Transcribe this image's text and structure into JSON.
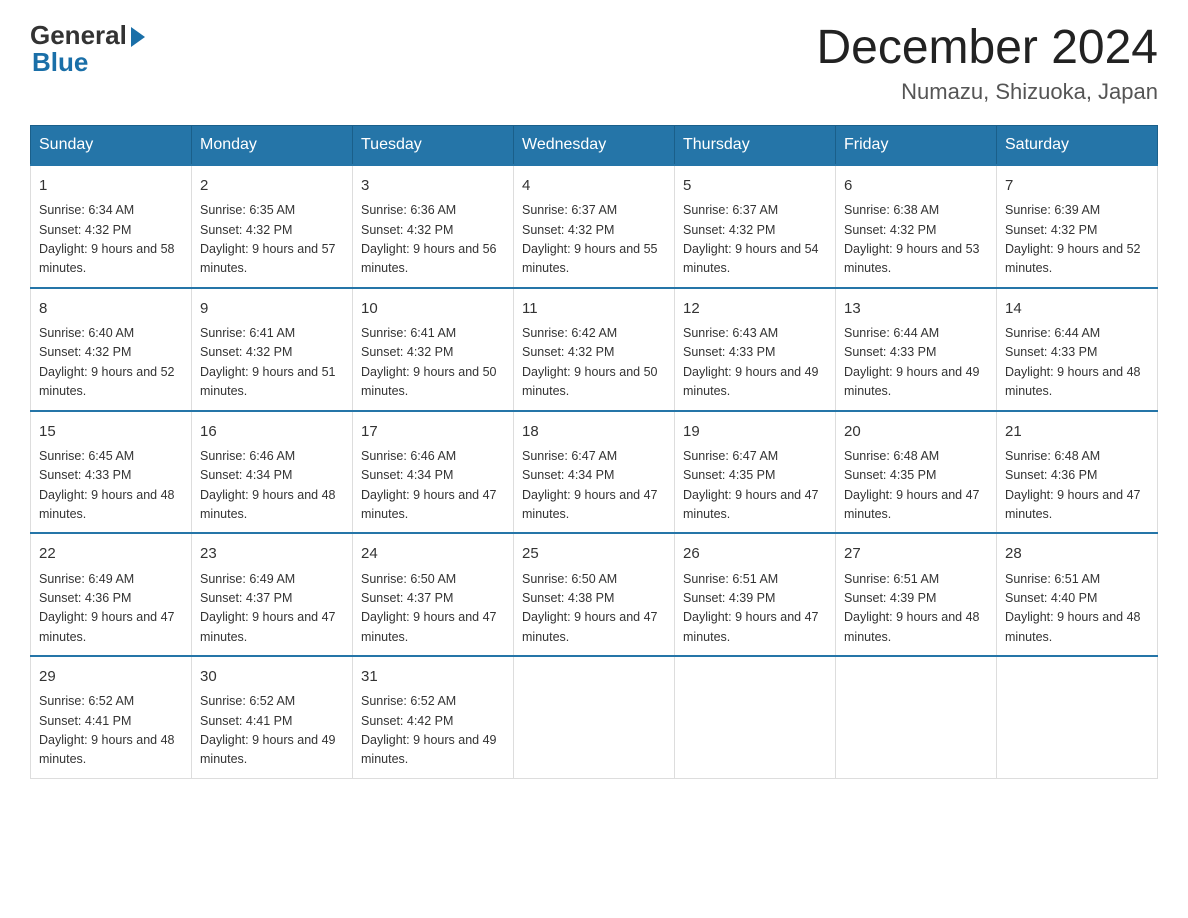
{
  "logo": {
    "text_general": "General",
    "text_blue": "Blue"
  },
  "title": "December 2024",
  "location": "Numazu, Shizuoka, Japan",
  "days_of_week": [
    "Sunday",
    "Monday",
    "Tuesday",
    "Wednesday",
    "Thursday",
    "Friday",
    "Saturday"
  ],
  "weeks": [
    [
      {
        "day": "1",
        "sunrise": "6:34 AM",
        "sunset": "4:32 PM",
        "daylight": "9 hours and 58 minutes."
      },
      {
        "day": "2",
        "sunrise": "6:35 AM",
        "sunset": "4:32 PM",
        "daylight": "9 hours and 57 minutes."
      },
      {
        "day": "3",
        "sunrise": "6:36 AM",
        "sunset": "4:32 PM",
        "daylight": "9 hours and 56 minutes."
      },
      {
        "day": "4",
        "sunrise": "6:37 AM",
        "sunset": "4:32 PM",
        "daylight": "9 hours and 55 minutes."
      },
      {
        "day": "5",
        "sunrise": "6:37 AM",
        "sunset": "4:32 PM",
        "daylight": "9 hours and 54 minutes."
      },
      {
        "day": "6",
        "sunrise": "6:38 AM",
        "sunset": "4:32 PM",
        "daylight": "9 hours and 53 minutes."
      },
      {
        "day": "7",
        "sunrise": "6:39 AM",
        "sunset": "4:32 PM",
        "daylight": "9 hours and 52 minutes."
      }
    ],
    [
      {
        "day": "8",
        "sunrise": "6:40 AM",
        "sunset": "4:32 PM",
        "daylight": "9 hours and 52 minutes."
      },
      {
        "day": "9",
        "sunrise": "6:41 AM",
        "sunset": "4:32 PM",
        "daylight": "9 hours and 51 minutes."
      },
      {
        "day": "10",
        "sunrise": "6:41 AM",
        "sunset": "4:32 PM",
        "daylight": "9 hours and 50 minutes."
      },
      {
        "day": "11",
        "sunrise": "6:42 AM",
        "sunset": "4:32 PM",
        "daylight": "9 hours and 50 minutes."
      },
      {
        "day": "12",
        "sunrise": "6:43 AM",
        "sunset": "4:33 PM",
        "daylight": "9 hours and 49 minutes."
      },
      {
        "day": "13",
        "sunrise": "6:44 AM",
        "sunset": "4:33 PM",
        "daylight": "9 hours and 49 minutes."
      },
      {
        "day": "14",
        "sunrise": "6:44 AM",
        "sunset": "4:33 PM",
        "daylight": "9 hours and 48 minutes."
      }
    ],
    [
      {
        "day": "15",
        "sunrise": "6:45 AM",
        "sunset": "4:33 PM",
        "daylight": "9 hours and 48 minutes."
      },
      {
        "day": "16",
        "sunrise": "6:46 AM",
        "sunset": "4:34 PM",
        "daylight": "9 hours and 48 minutes."
      },
      {
        "day": "17",
        "sunrise": "6:46 AM",
        "sunset": "4:34 PM",
        "daylight": "9 hours and 47 minutes."
      },
      {
        "day": "18",
        "sunrise": "6:47 AM",
        "sunset": "4:34 PM",
        "daylight": "9 hours and 47 minutes."
      },
      {
        "day": "19",
        "sunrise": "6:47 AM",
        "sunset": "4:35 PM",
        "daylight": "9 hours and 47 minutes."
      },
      {
        "day": "20",
        "sunrise": "6:48 AM",
        "sunset": "4:35 PM",
        "daylight": "9 hours and 47 minutes."
      },
      {
        "day": "21",
        "sunrise": "6:48 AM",
        "sunset": "4:36 PM",
        "daylight": "9 hours and 47 minutes."
      }
    ],
    [
      {
        "day": "22",
        "sunrise": "6:49 AM",
        "sunset": "4:36 PM",
        "daylight": "9 hours and 47 minutes."
      },
      {
        "day": "23",
        "sunrise": "6:49 AM",
        "sunset": "4:37 PM",
        "daylight": "9 hours and 47 minutes."
      },
      {
        "day": "24",
        "sunrise": "6:50 AM",
        "sunset": "4:37 PM",
        "daylight": "9 hours and 47 minutes."
      },
      {
        "day": "25",
        "sunrise": "6:50 AM",
        "sunset": "4:38 PM",
        "daylight": "9 hours and 47 minutes."
      },
      {
        "day": "26",
        "sunrise": "6:51 AM",
        "sunset": "4:39 PM",
        "daylight": "9 hours and 47 minutes."
      },
      {
        "day": "27",
        "sunrise": "6:51 AM",
        "sunset": "4:39 PM",
        "daylight": "9 hours and 48 minutes."
      },
      {
        "day": "28",
        "sunrise": "6:51 AM",
        "sunset": "4:40 PM",
        "daylight": "9 hours and 48 minutes."
      }
    ],
    [
      {
        "day": "29",
        "sunrise": "6:52 AM",
        "sunset": "4:41 PM",
        "daylight": "9 hours and 48 minutes."
      },
      {
        "day": "30",
        "sunrise": "6:52 AM",
        "sunset": "4:41 PM",
        "daylight": "9 hours and 49 minutes."
      },
      {
        "day": "31",
        "sunrise": "6:52 AM",
        "sunset": "4:42 PM",
        "daylight": "9 hours and 49 minutes."
      },
      null,
      null,
      null,
      null
    ]
  ]
}
